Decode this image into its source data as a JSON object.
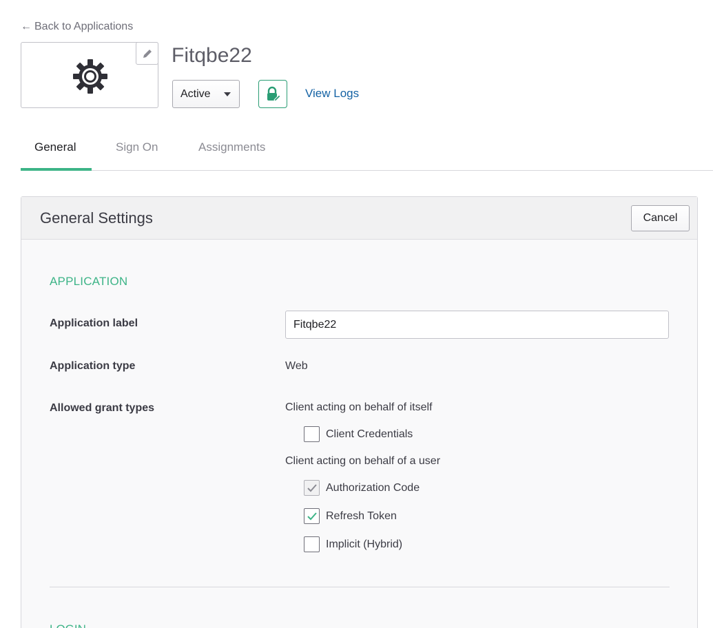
{
  "nav": {
    "back_arrow": "←",
    "back_label": "Back to Applications"
  },
  "app": {
    "title": "Fitqbe22",
    "logo_icon": "gear-icon",
    "status": "Active",
    "view_logs": "View Logs"
  },
  "tabs": [
    {
      "label": "General",
      "active": true
    },
    {
      "label": "Sign On",
      "active": false
    },
    {
      "label": "Assignments",
      "active": false
    }
  ],
  "panel": {
    "title": "General Settings",
    "cancel_label": "Cancel",
    "section_application": "APPLICATION",
    "fields": {
      "app_label": {
        "label": "Application label",
        "value": "Fitqbe22"
      },
      "app_type": {
        "label": "Application type",
        "value": "Web"
      },
      "grant_types": {
        "label": "Allowed grant types",
        "group_self": "Client acting on behalf of itself",
        "group_user": "Client acting on behalf of a user",
        "options": [
          {
            "label": "Client Credentials",
            "checked": false,
            "disabled": false
          },
          {
            "label": "Authorization Code",
            "checked": true,
            "disabled": true
          },
          {
            "label": "Refresh Token",
            "checked": true,
            "disabled": false
          },
          {
            "label": "Implicit (Hybrid)",
            "checked": false,
            "disabled": false
          }
        ]
      }
    },
    "section_login": "LOGIN"
  },
  "colors": {
    "accent": "#3db487",
    "link": "#1462a4",
    "lock_border": "#2a9d74"
  }
}
